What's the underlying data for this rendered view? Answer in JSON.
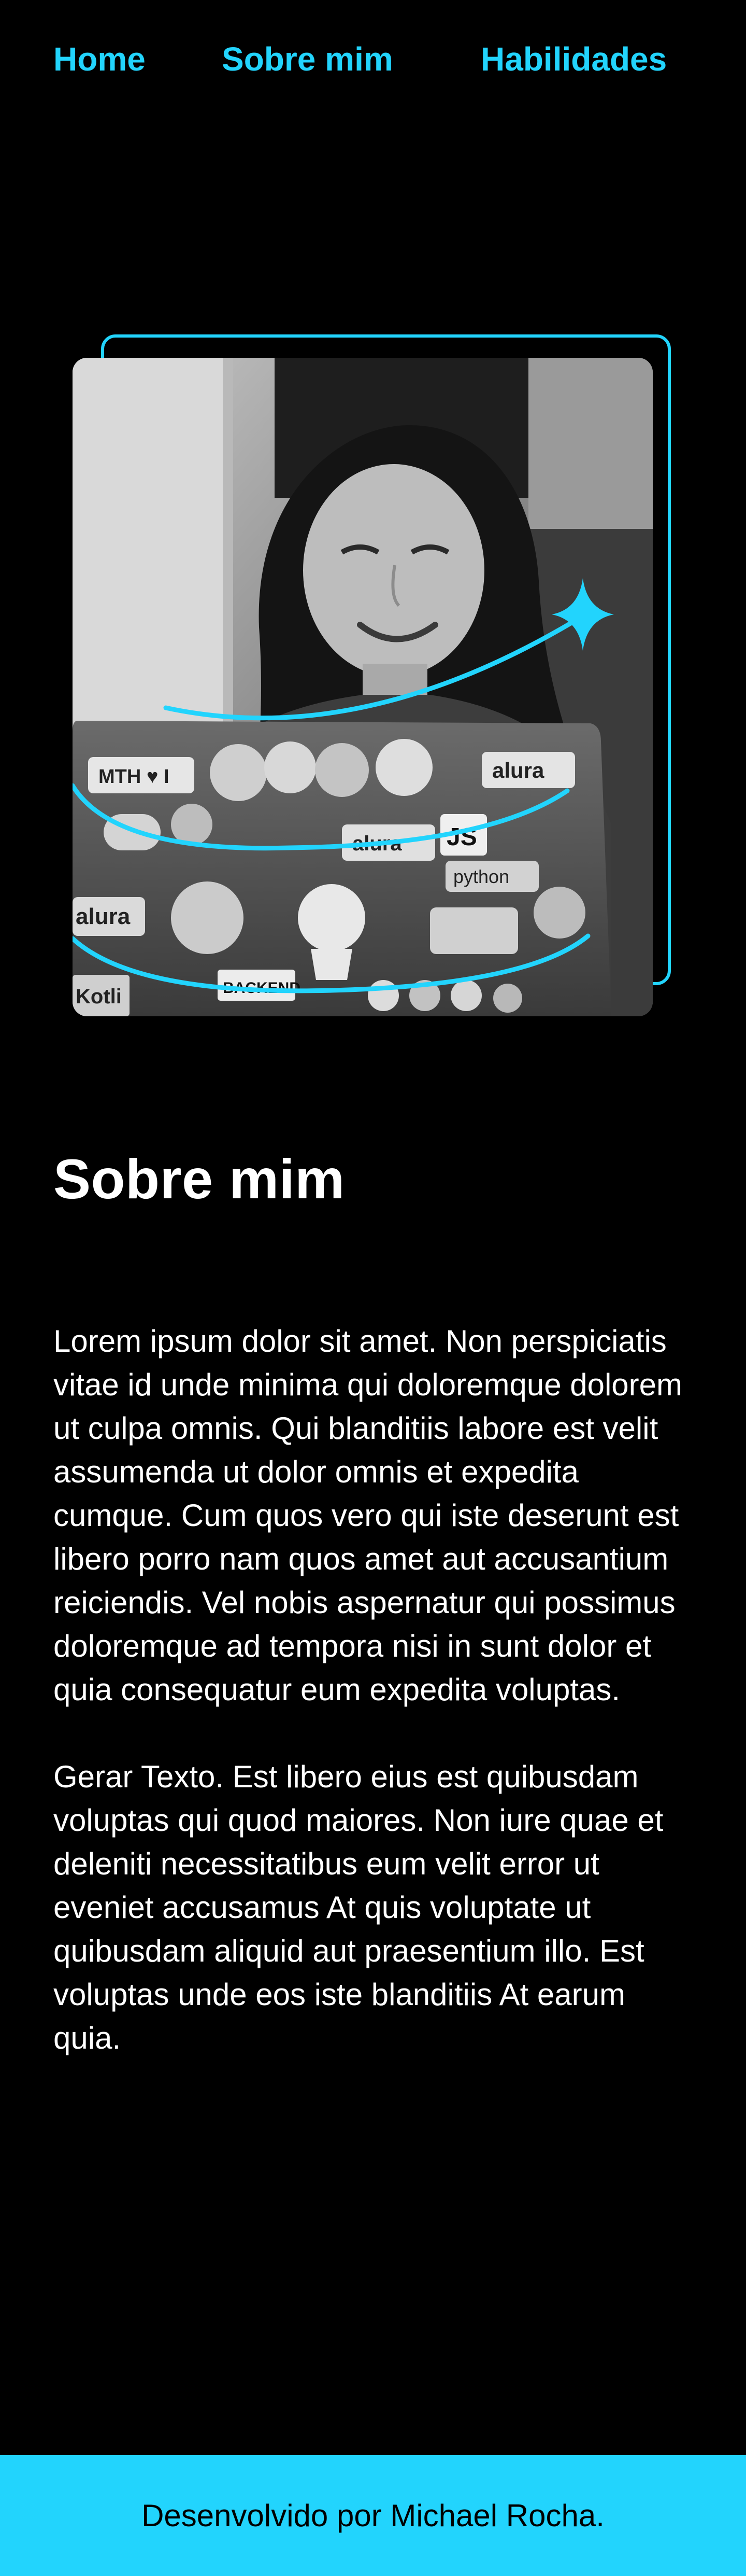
{
  "colors": {
    "accent": "#22D4FD",
    "background": "#000000",
    "text": "#FFFFFF",
    "footer_text": "#000000"
  },
  "nav": {
    "items": [
      {
        "label": "Home"
      },
      {
        "label": "Sobre mim"
      },
      {
        "label": "Habilidades"
      }
    ]
  },
  "hero": {
    "image_description": "Black-and-white photo of a smiling woman using a sticker-covered laptop",
    "laptop_sticker_texts": [
      "alura",
      "JS",
      "python",
      "MTH",
      "BACKEND",
      "Kotlin"
    ]
  },
  "about": {
    "title": "Sobre mim",
    "paragraphs": [
      "Lorem ipsum dolor sit amet. Non perspiciatis vitae id unde minima qui doloremque dolorem ut culpa omnis. Qui blanditiis labore est velit assumenda ut dolor omnis et expedita cumque. Cum quos vero qui iste deserunt est libero porro nam quos amet aut accusantium reiciendis. Vel nobis aspernatur qui possimus doloremque ad tempora nisi in sunt dolor et quia consequatur eum expedita voluptas.",
      "Gerar Texto. Est libero eius est quibusdam voluptas qui quod maiores. Non iure quae et deleniti necessitatibus eum velit error ut eveniet accusamus At quis voluptate ut quibusdam aliquid aut praesentium illo. Est voluptas unde eos iste blanditiis At earum quia."
    ]
  },
  "footer": {
    "text": "Desenvolvido por Michael Rocha."
  }
}
